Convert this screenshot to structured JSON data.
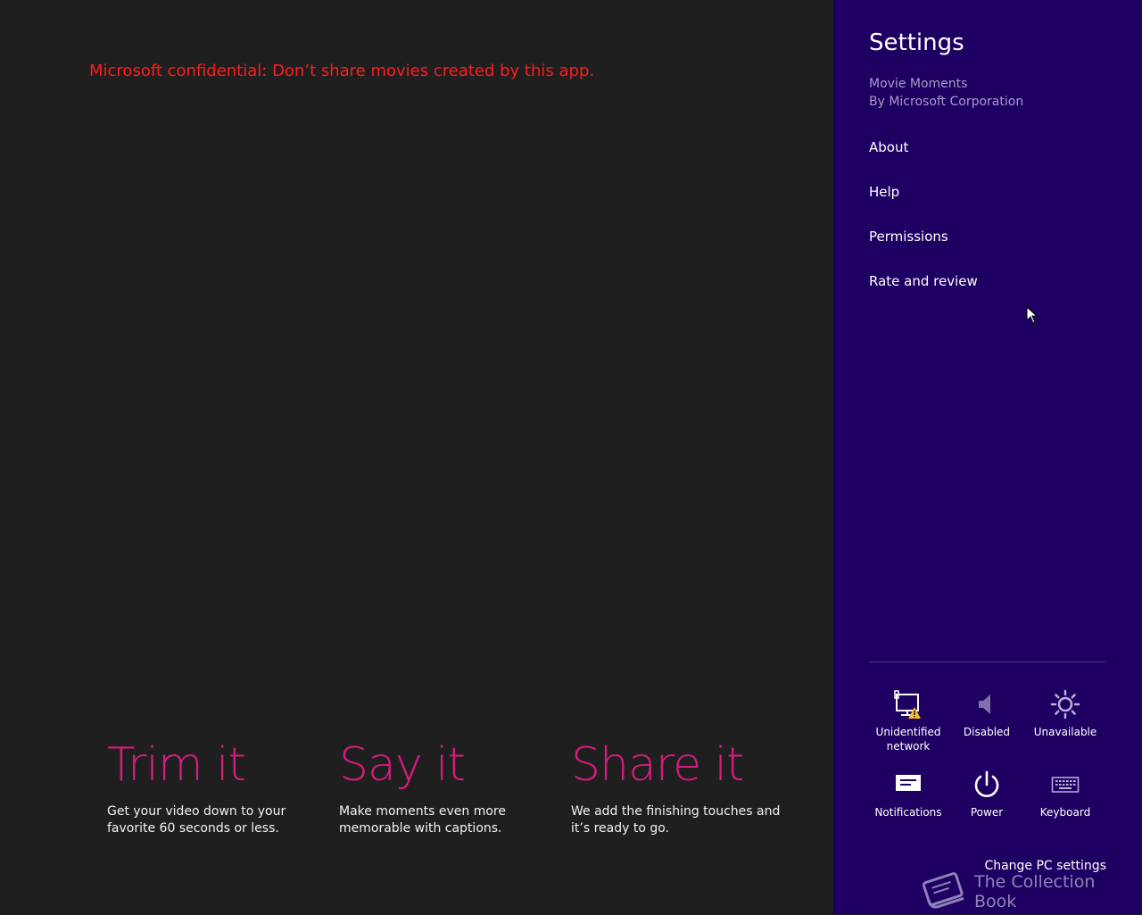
{
  "app": {
    "confidential_notice": "Microsoft confidential: Don’t share movies created by this app.",
    "features": [
      {
        "heading": "Trim it",
        "description": "Get your video down to your favorite 60 seconds or less."
      },
      {
        "heading": "Say it",
        "description": "Make moments even more memorable with captions."
      },
      {
        "heading": "Share it",
        "description": "We add the finishing touches and it’s ready to go."
      }
    ],
    "colors": {
      "background": "#1f1f1f",
      "notice": "#ff1c1c",
      "accent": "#d81b7e"
    }
  },
  "settings_charm": {
    "title": "Settings",
    "app_name": "Movie Moments",
    "publisher": "By Microsoft Corporation",
    "menu": [
      "About",
      "Help",
      "Permissions",
      "Rate and review"
    ],
    "quick_tiles": [
      {
        "icon": "network-warning-icon",
        "label": "Unidentified network"
      },
      {
        "icon": "speaker-icon",
        "label": "Disabled"
      },
      {
        "icon": "brightness-icon",
        "label": "Unavailable"
      },
      {
        "icon": "notifications-icon",
        "label": "Notifications"
      },
      {
        "icon": "power-icon",
        "label": "Power"
      },
      {
        "icon": "keyboard-icon",
        "label": "Keyboard"
      }
    ],
    "change_pc_settings": "Change PC settings",
    "colors": {
      "background": "#1e0063",
      "subtext": "#a79bc7"
    }
  },
  "watermark": {
    "icon": "book-icon",
    "text": "The Collection Book"
  }
}
